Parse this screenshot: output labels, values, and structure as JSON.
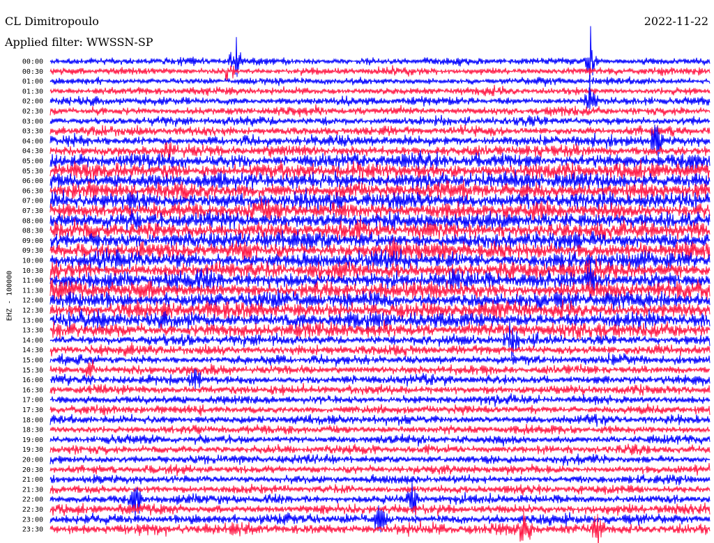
{
  "header": {
    "station": "CL Dimitropoulo",
    "filter": "Applied filter: WWSSN-SP",
    "date": "2022-11-22"
  },
  "chart_data": {
    "type": "helicorder",
    "ylabel": "EHZ - 100000",
    "row_labels": [
      "00:00",
      "00:30",
      "01:00",
      "01:30",
      "02:00",
      "02:30",
      "03:00",
      "03:30",
      "04:00",
      "04:30",
      "05:00",
      "05:30",
      "06:00",
      "06:30",
      "07:00",
      "07:30",
      "08:00",
      "08:30",
      "09:00",
      "09:30",
      "10:00",
      "10:30",
      "11:00",
      "11:30",
      "12:00",
      "12:30",
      "13:00",
      "13:30",
      "14:00",
      "14:30",
      "15:00",
      "15:30",
      "16:00",
      "16:30",
      "17:00",
      "17:30",
      "18:00",
      "18:30",
      "19:00",
      "19:30",
      "20:00",
      "20:30",
      "21:00",
      "21:30",
      "22:00",
      "22:30",
      "23:00",
      "23:30"
    ],
    "trace_colors": [
      "#0000ff",
      "#ff1744"
    ],
    "row_activity": [
      0.3,
      0.3,
      0.3,
      0.32,
      0.38,
      0.38,
      0.4,
      0.45,
      0.55,
      0.6,
      0.85,
      0.95,
      1.0,
      1.0,
      1.0,
      1.0,
      1.0,
      1.0,
      1.0,
      1.0,
      1.0,
      1.0,
      1.0,
      1.0,
      1.0,
      1.0,
      0.95,
      0.85,
      0.55,
      0.5,
      0.45,
      0.45,
      0.45,
      0.45,
      0.42,
      0.42,
      0.42,
      0.4,
      0.4,
      0.4,
      0.4,
      0.4,
      0.38,
      0.4,
      0.45,
      0.5,
      0.55,
      0.6
    ],
    "events": [
      {
        "time": "00:30",
        "position": 0.27,
        "strength": 0.9
      },
      {
        "time": "00:00",
        "position": 0.28,
        "strength": 1.8
      },
      {
        "time": "00:00",
        "position": 0.82,
        "strength": 2.2
      },
      {
        "time": "02:00",
        "position": 0.82,
        "strength": 1.4
      },
      {
        "time": "04:00",
        "position": 0.92,
        "strength": 1.5
      },
      {
        "time": "04:30",
        "position": 0.18,
        "strength": 1.0
      },
      {
        "time": "09:30",
        "position": 0.52,
        "strength": 1.3
      },
      {
        "time": "10:30",
        "position": 0.82,
        "strength": 1.2
      },
      {
        "time": "11:00",
        "position": 0.82,
        "strength": 1.4
      },
      {
        "time": "14:00",
        "position": 0.7,
        "strength": 1.2
      },
      {
        "time": "15:30",
        "position": 0.06,
        "strength": 1.0
      },
      {
        "time": "16:00",
        "position": 0.22,
        "strength": 1.1
      },
      {
        "time": "22:00",
        "position": 0.13,
        "strength": 1.3
      },
      {
        "time": "22:00",
        "position": 0.55,
        "strength": 1.6
      },
      {
        "time": "23:00",
        "position": 0.5,
        "strength": 1.1
      },
      {
        "time": "23:30",
        "position": 0.72,
        "strength": 1.3
      },
      {
        "time": "23:30",
        "position": 0.83,
        "strength": 1.3
      }
    ]
  }
}
